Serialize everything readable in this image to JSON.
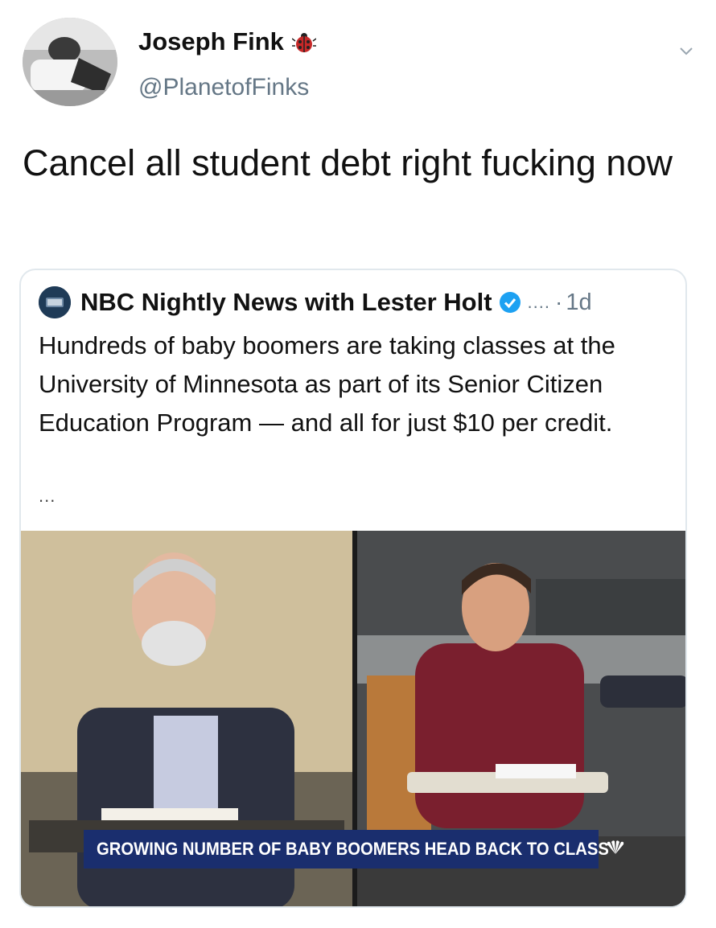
{
  "tweet": {
    "display_name": "Joseph Fink",
    "handle": "@PlanetofFinks",
    "text": "Cancel all student debt right fucking now",
    "name_icon": "ladybug-icon",
    "menu_icon": "chevron-down-icon"
  },
  "quoted_tweet": {
    "account_name": "NBC Nightly News with Lester Holt",
    "handle_truncated": "....",
    "separator": "·",
    "time": "1d",
    "text": "Hundreds of baby boomers are taking classes at the University of Minnesota as part of its Senior Citizen Education Program — and all for just $10 per credit.",
    "more": "...",
    "verified_icon": "verified-badge-icon",
    "media": {
      "chyron": "GROWING NUMBER OF BABY BOOMERS HEAD BACK TO CLASS",
      "logo": "nbc-peacock-icon"
    }
  },
  "colors": {
    "text": "#14171a",
    "secondary": "#657786",
    "verified": "#1da1f2",
    "chyron_bg": "#1a2e6e",
    "card_border": "#e1e8ed"
  }
}
